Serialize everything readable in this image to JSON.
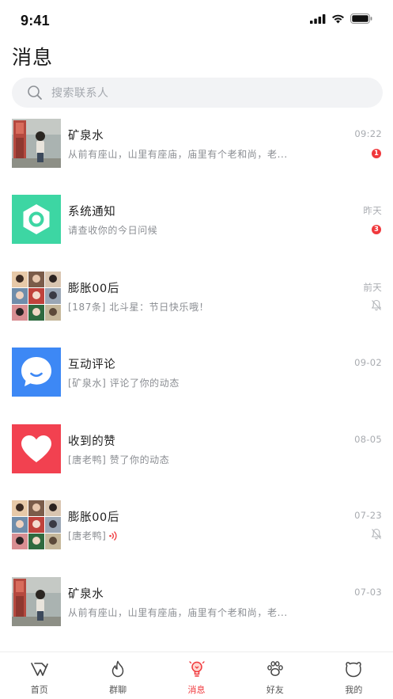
{
  "status_bar": {
    "time": "9:41",
    "icons": [
      "cellular-signal-icon",
      "wifi-icon",
      "battery-icon"
    ]
  },
  "page_title": "消息",
  "search": {
    "placeholder": "搜索联系人"
  },
  "conversations": [
    {
      "name": "矿泉水",
      "preview": "从前有座山，山里有座庙，庙里有个老和尚，老...",
      "time": "09:22",
      "badge": "1",
      "avatar": "photo-avatar"
    },
    {
      "name": "系统通知",
      "preview": "请查收你的今日问候",
      "time": "昨天",
      "badge": "3",
      "avatar": "system-notice-icon"
    },
    {
      "name": "膨胀00后",
      "preview": "[187条] 北斗星：节日快乐哦！",
      "time": "前天",
      "muted": true,
      "avatar": "group-collage-avatar"
    },
    {
      "name": "互动评论",
      "preview": "[矿泉水] 评论了你的动态",
      "time": "09-02",
      "avatar": "comment-bubble-icon"
    },
    {
      "name": "收到的赞",
      "preview": "[唐老鸭] 赞了你的动态",
      "time": "08-05",
      "avatar": "heart-icon"
    },
    {
      "name": "膨胀00后",
      "preview": "[唐老鸭]",
      "time": "07-23",
      "muted": true,
      "voice": true,
      "avatar": "group-collage-avatar"
    },
    {
      "name": "矿泉水",
      "preview": "从前有座山，山里有座庙，庙里有个老和尚，老...",
      "time": "07-03",
      "avatar": "photo-avatar"
    }
  ],
  "tab_bar": {
    "tabs": [
      {
        "label": "首页",
        "icon": "home-logo-icon"
      },
      {
        "label": "群聊",
        "icon": "flame-icon"
      },
      {
        "label": "消息",
        "icon": "lightbulb-icon",
        "active": true
      },
      {
        "label": "好友",
        "icon": "paw-icon"
      },
      {
        "label": "我的",
        "icon": "bear-face-icon"
      }
    ]
  },
  "colors": {
    "accent": "#f0383c",
    "system_notice": "#3dd6a3",
    "comment": "#3d88f5",
    "like": "#f24150",
    "text_secondary": "#8a8d92"
  }
}
